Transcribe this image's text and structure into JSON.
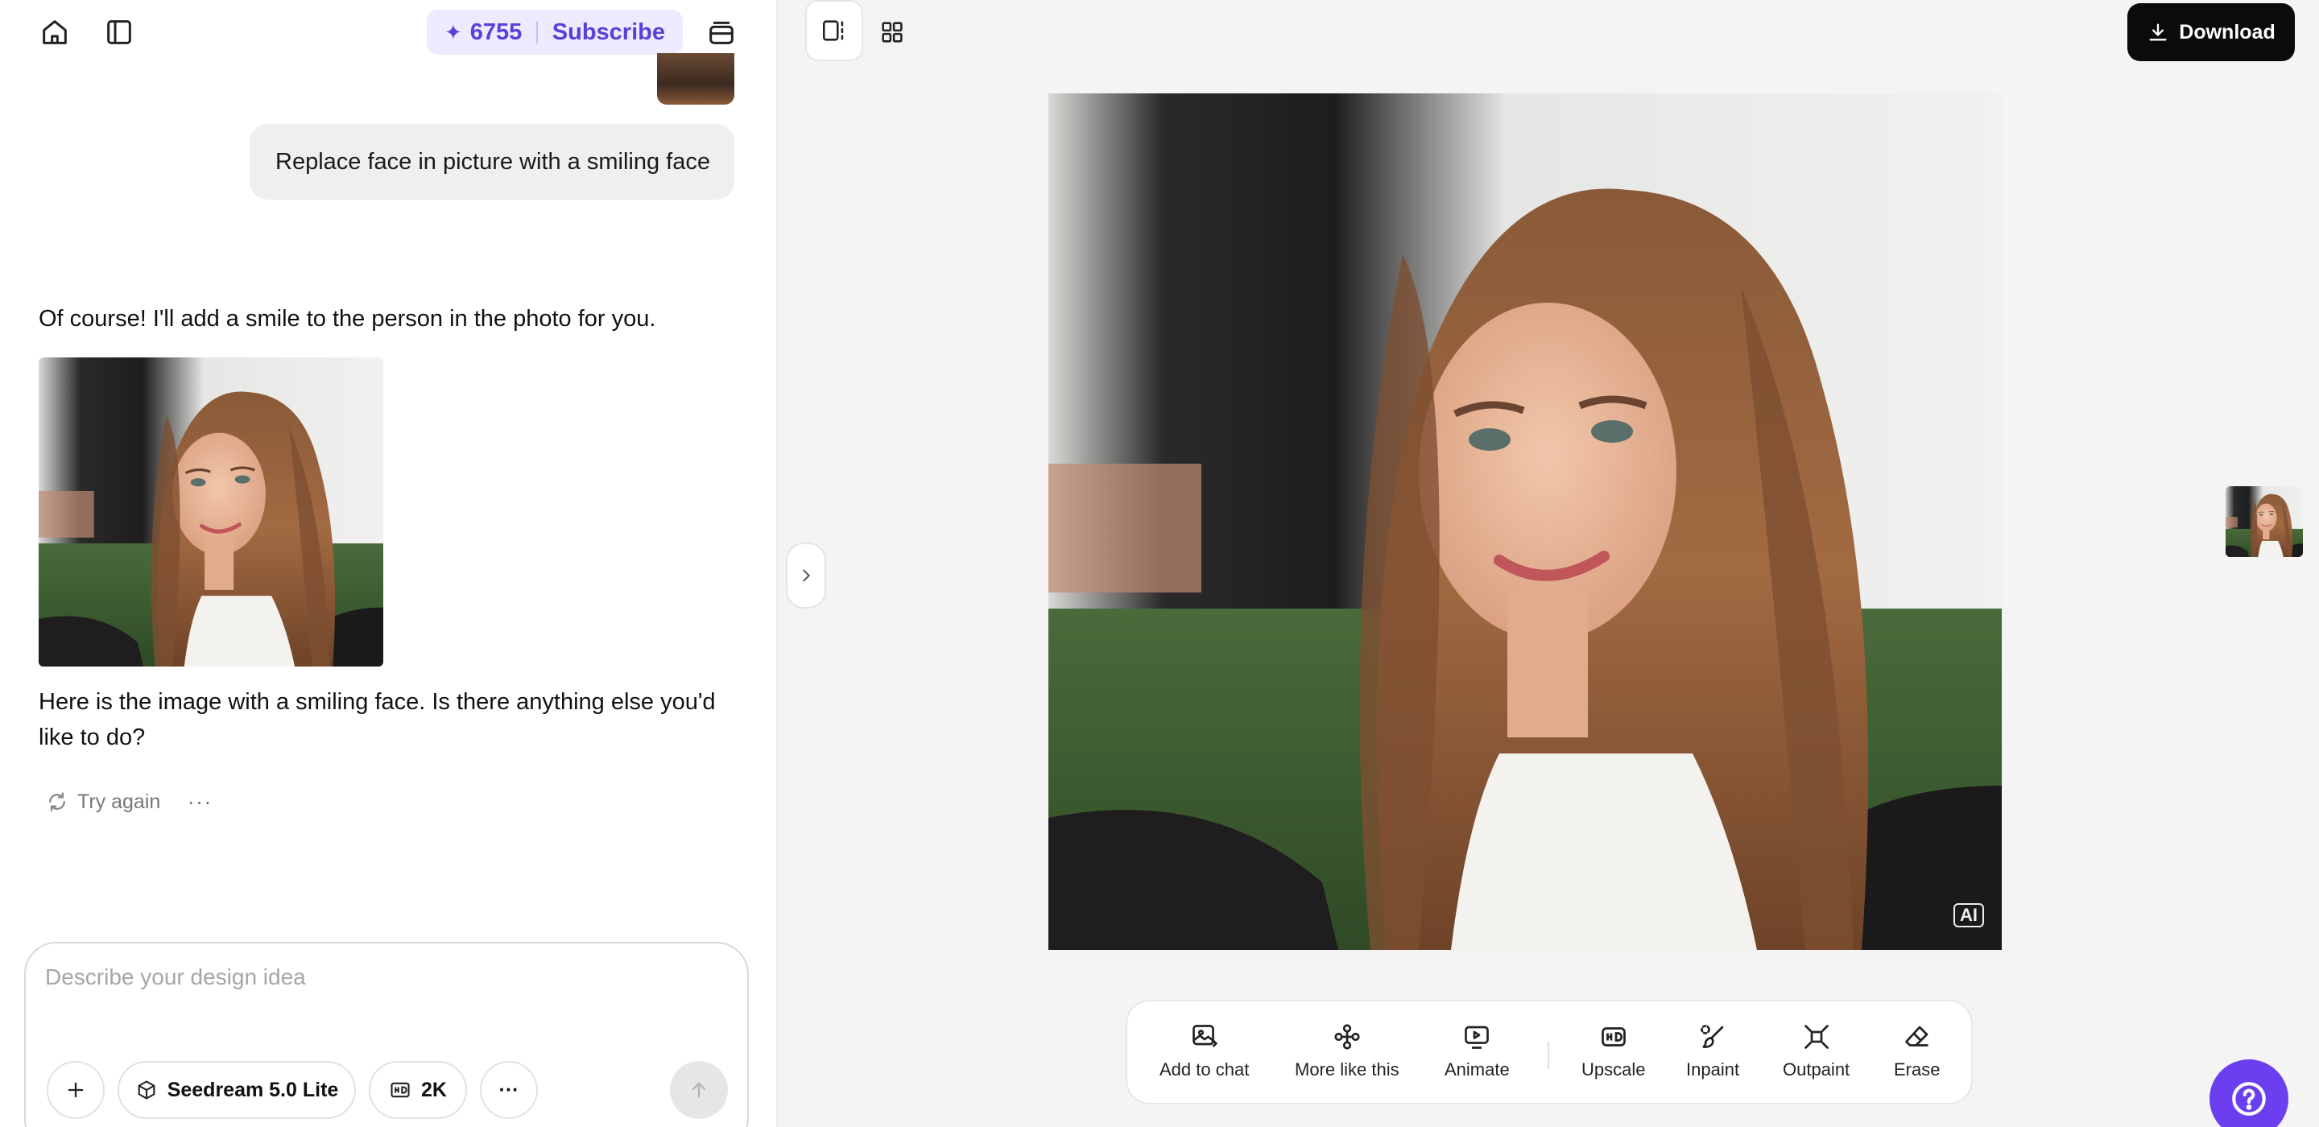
{
  "header": {
    "credits": "6755",
    "subscribe_label": "Subscribe"
  },
  "chat": {
    "user_message": "Replace face in picture with a smiling face",
    "assistant_reply_1": "Of course! I'll add a smile to the person in the photo for you.",
    "assistant_reply_2": "Here is the image with a smiling face. Is there anything else you'd like to do?",
    "try_again_label": "Try again",
    "more_label": "···"
  },
  "composer": {
    "placeholder": "Describe your design idea",
    "value": "",
    "model_label": "Seedream 5.0 Lite",
    "resolution_label": "2K",
    "more_label": "···"
  },
  "canvas": {
    "download_label": "Download",
    "ai_badge": "AI"
  },
  "toolbar": {
    "tools": [
      {
        "label": "Add to chat"
      },
      {
        "label": "More like this"
      },
      {
        "label": "Animate"
      },
      {
        "label": "Upscale"
      },
      {
        "label": "Inpaint"
      },
      {
        "label": "Outpaint"
      },
      {
        "label": "Erase"
      }
    ]
  },
  "colors": {
    "accent": "#6b3ff0",
    "credits_bg": "#eeeaff",
    "credits_text": "#5b3fd6",
    "download_bg": "#0b0b0b"
  }
}
